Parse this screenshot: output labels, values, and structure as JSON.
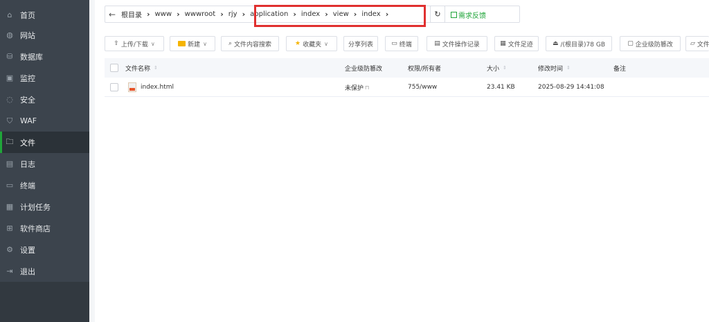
{
  "sidebar": {
    "items": [
      {
        "label": "首页",
        "icon": "home-icon",
        "glyph": "⌂"
      },
      {
        "label": "网站",
        "icon": "globe-icon",
        "glyph": "◍"
      },
      {
        "label": "数据库",
        "icon": "database-icon",
        "glyph": "⛁"
      },
      {
        "label": "监控",
        "icon": "monitor-icon",
        "glyph": "▣"
      },
      {
        "label": "安全",
        "icon": "shield-icon",
        "glyph": "◌"
      },
      {
        "label": "WAF",
        "icon": "waf-shield-icon",
        "glyph": "⛉"
      },
      {
        "label": "文件",
        "icon": "folder-icon",
        "glyph": "🗀"
      },
      {
        "label": "日志",
        "icon": "log-icon",
        "glyph": "▤"
      },
      {
        "label": "终端",
        "icon": "terminal-icon",
        "glyph": "▭"
      },
      {
        "label": "计划任务",
        "icon": "calendar-icon",
        "glyph": "▦"
      },
      {
        "label": "软件商店",
        "icon": "apps-icon",
        "glyph": "⊞"
      },
      {
        "label": "设置",
        "icon": "gear-icon",
        "glyph": "⚙"
      },
      {
        "label": "退出",
        "icon": "logout-icon",
        "glyph": "⇥"
      }
    ],
    "active_index": 6
  },
  "pathbar": {
    "back_glyph": "←",
    "crumbs": [
      "根目录",
      "www",
      "wwwroot",
      "rjy",
      "application",
      "index",
      "view",
      "index"
    ],
    "separator": "›",
    "refresh_glyph": "↻",
    "feedback_label": "需求反馈"
  },
  "toolbar": {
    "upload": "上传/下载",
    "new": "新建",
    "search": "文件内容搜索",
    "favorites": "收藏夹",
    "share_list": "分享列表",
    "terminal": "终端",
    "op_log": "文件操作记录",
    "footprint": "文件足迹",
    "disk": "/(根目录)78 GB",
    "tamper": "企业级防篡改",
    "more": "文件"
  },
  "table": {
    "headers": {
      "name": "文件名称",
      "tamper": "企业级防篡改",
      "perm": "权限/所有者",
      "size": "大小",
      "mtime": "修改时间",
      "remark": "备注"
    },
    "rows": [
      {
        "name": "index.html",
        "tamper": "未保护",
        "perm": "755/www",
        "size": "23.41 KB",
        "mtime": "2025-08-29 14:41:08",
        "remark": ""
      }
    ]
  },
  "colors": {
    "sidebar_bg": "#3c444d",
    "active_accent": "#20a53a",
    "highlight": "#e0302f"
  }
}
